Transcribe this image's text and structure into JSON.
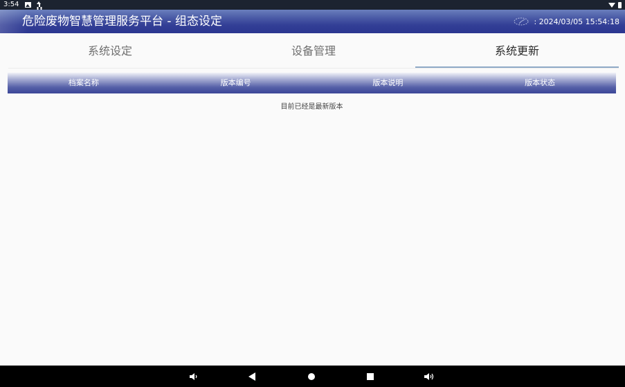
{
  "status_bar": {
    "time": "3:54",
    "icons": [
      "image-icon",
      "upload-icon",
      "wifi-icon",
      "battery-icon"
    ]
  },
  "header": {
    "title": "危险废物智慧管理服务平台 - 组态设定",
    "datetime": ": 2024/03/05 15:54:18",
    "colors": {
      "bar_top": "#6a7fbd",
      "bar_bottom": "#2b3690"
    }
  },
  "tabs": [
    {
      "label": "系统设定",
      "active": false
    },
    {
      "label": "设备管理",
      "active": false
    },
    {
      "label": "系统更新",
      "active": true
    }
  ],
  "table": {
    "columns": [
      "档案名称",
      "版本编号",
      "版本说明",
      "版本状态"
    ],
    "rows": [],
    "empty_message": "目前已经是最新版本"
  },
  "nav_bar": {
    "buttons": [
      "volume-down-icon",
      "back-icon",
      "home-icon",
      "recent-apps-icon",
      "volume-up-icon"
    ]
  },
  "accent": "#8fa9c6"
}
